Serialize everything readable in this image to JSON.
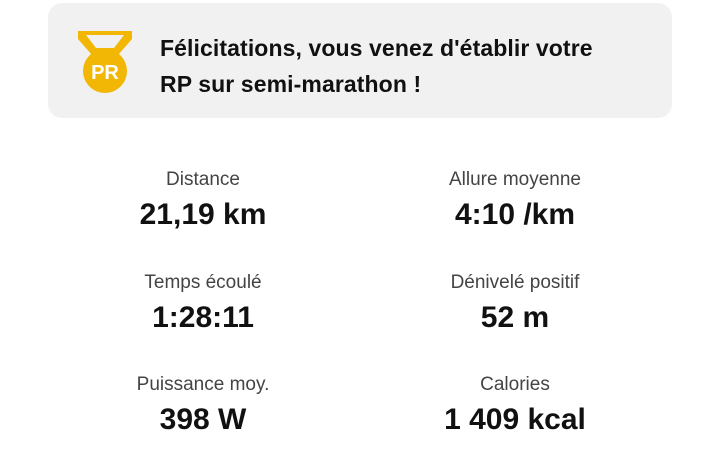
{
  "banner": {
    "badge_text": "PR",
    "message_line1": "Félicitations, vous venez d'établir votre",
    "message_line2": "RP sur semi-marathon !",
    "accent_color": "#f2b705"
  },
  "stats": [
    {
      "label": "Distance",
      "value": "21,19 km"
    },
    {
      "label": "Allure moyenne",
      "value": "4:10 /km"
    },
    {
      "label": "Temps écoulé",
      "value": "1:28:11"
    },
    {
      "label": "Dénivelé positif",
      "value": "52 m"
    },
    {
      "label": "Puissance moy.",
      "value": "398 W"
    },
    {
      "label": "Calories",
      "value": "1 409 kcal"
    }
  ]
}
